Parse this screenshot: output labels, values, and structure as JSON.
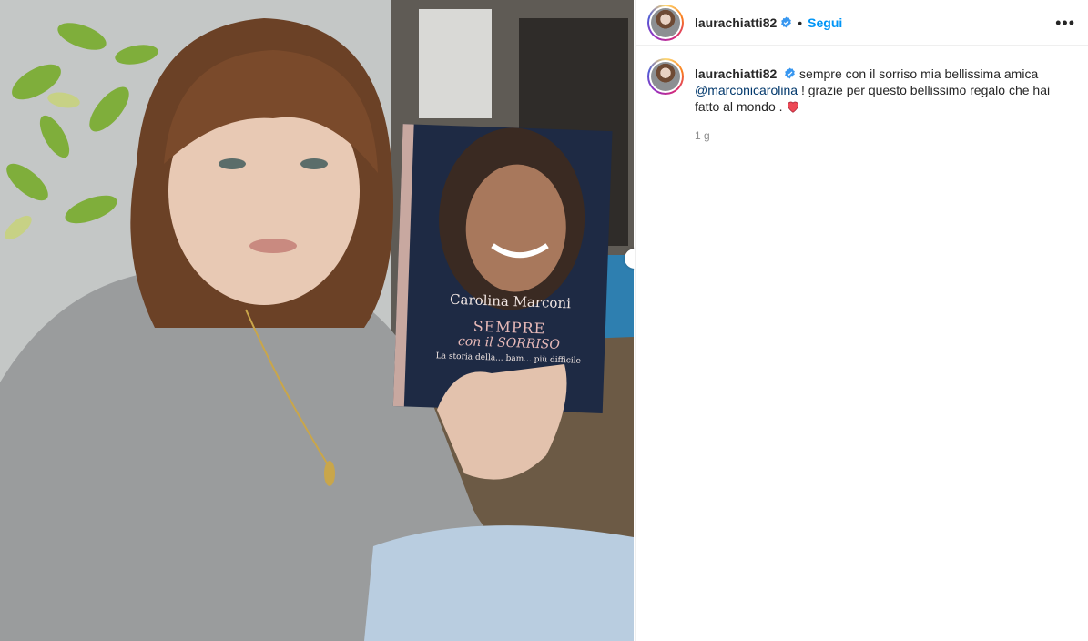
{
  "post": {
    "username": "laurachiatti82",
    "follow_label": "Segui",
    "more_label": "•••",
    "caption": {
      "text_before_mention": "sempre con il sorriso mia bellissima amica",
      "mention": "@marconicarolina",
      "text_after_mention": "! grazie per questo bellissimo regalo che hai fatto al mondo ."
    },
    "timestamp": "1 g"
  },
  "book": {
    "author": "Carolina Marconi",
    "title_line1": "SEMPRE",
    "title_line2": "con il SORRISO",
    "subtitle": "La storia della... bam... più difficile"
  },
  "colors": {
    "follow_blue": "#0095f6",
    "mention_blue": "#00376b",
    "verified_blue": "#3897f0",
    "heart_red": "#ed4956"
  },
  "icons": [
    "verified-badge-icon",
    "more-options-icon",
    "heart-emoji-icon"
  ]
}
